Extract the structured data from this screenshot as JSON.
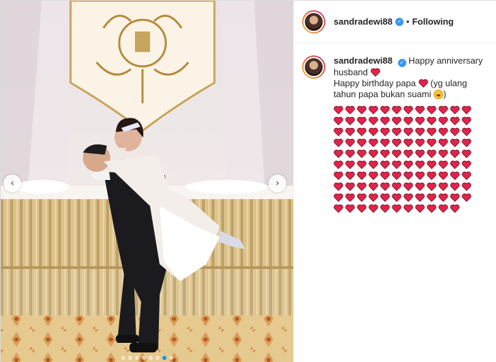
{
  "post": {
    "username": "sandradewi88",
    "follow_status": "Following",
    "separator": "•",
    "verified_icon": "verified-badge-icon"
  },
  "caption": {
    "username": "sandradewi88",
    "line1": "Happy anniversary husband",
    "line2": "Happy birthday papa",
    "line3": "(yg ulang tahun papa bukan suami",
    "line3_end": ")",
    "hearts_rows": 10,
    "hearts_per_row": 12,
    "hearts_last_row": 11,
    "emoji_heart": "red-heart",
    "emoji_laugh": "rolling-laughing"
  },
  "carousel": {
    "slide_count": 8,
    "active_slide": 7,
    "prev_label": "‹",
    "next_label": "›"
  },
  "colors": {
    "accent_blue": "#0095f6",
    "heart_red": "#e0244a",
    "text": "#262626"
  }
}
